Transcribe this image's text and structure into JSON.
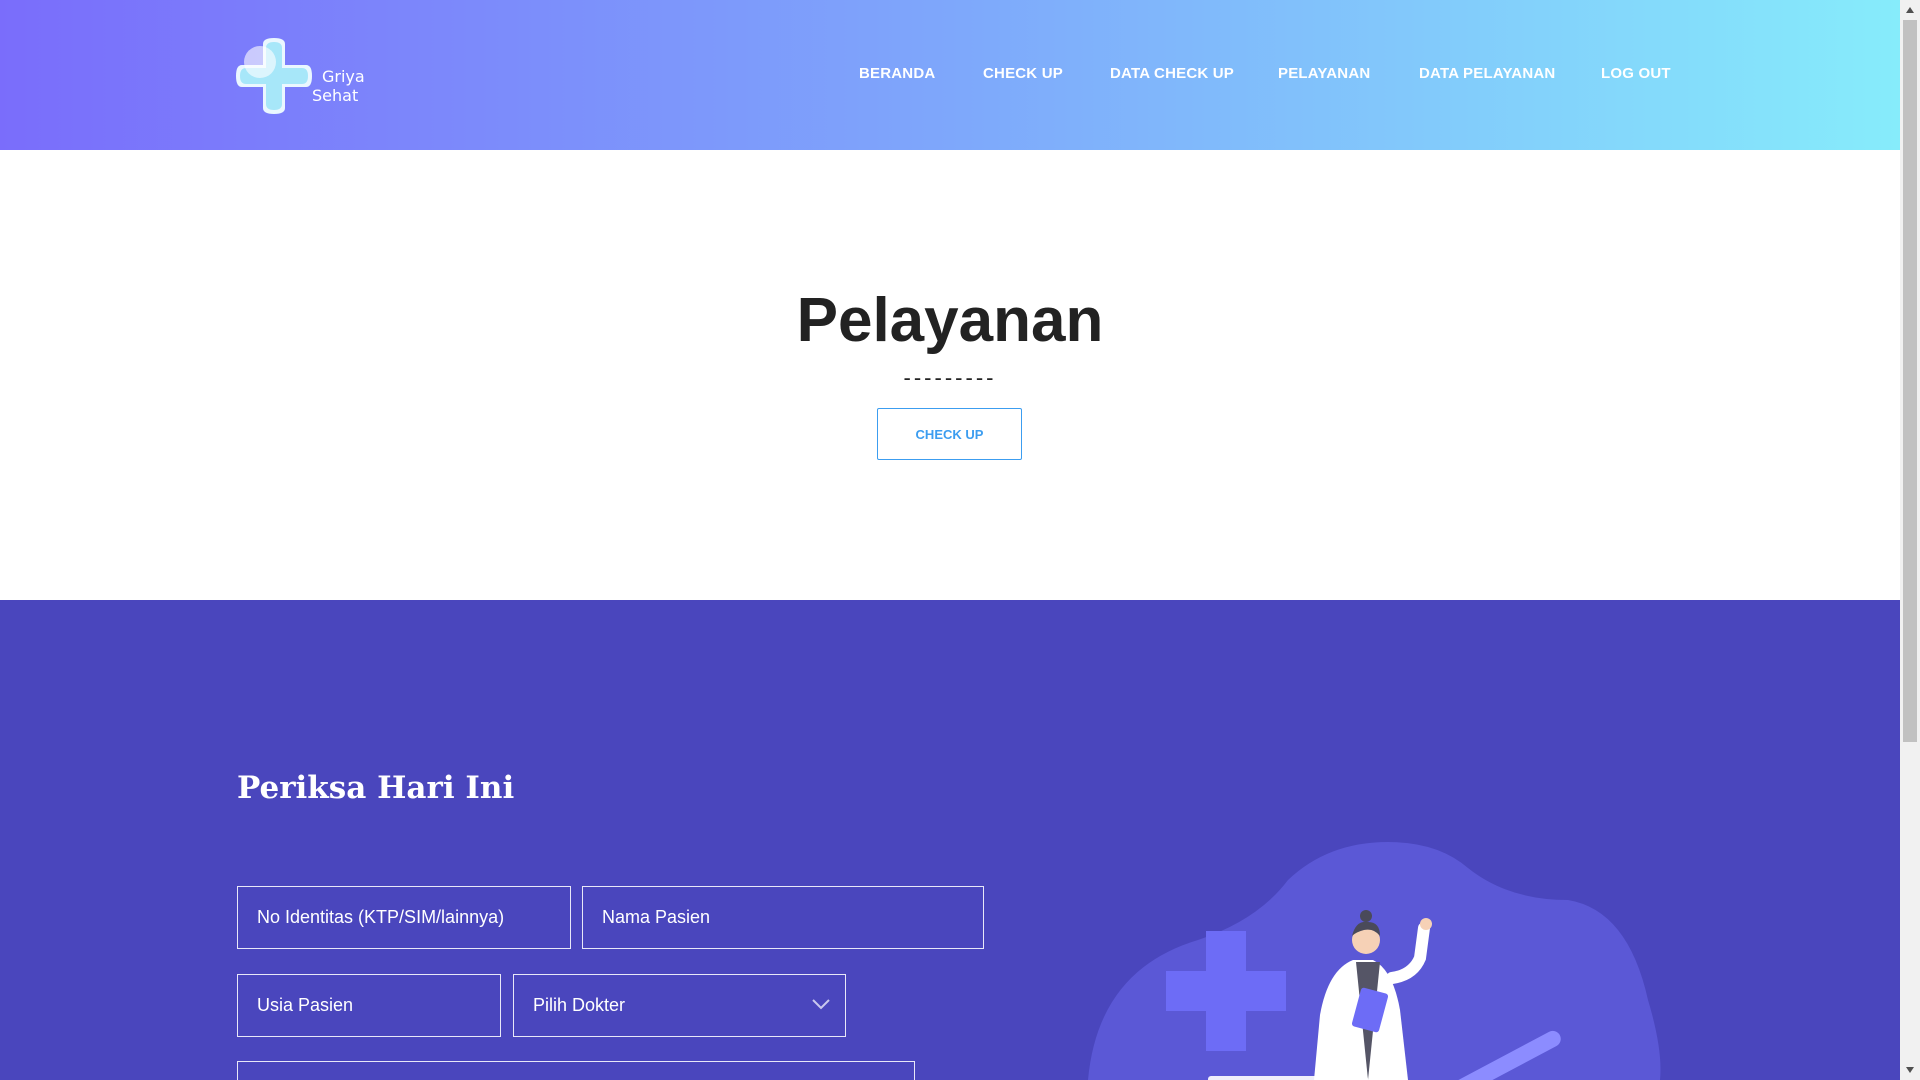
{
  "brand": {
    "line1": "Griya",
    "line2": "Sehat",
    "logo_icon": "medical-cross-logo"
  },
  "nav": {
    "beranda": "BERANDA",
    "check_up": "CHECK UP",
    "data_check_up": "DATA CHECK UP",
    "pelayanan": "PELAYANAN",
    "data_pelayanan": "DATA PELAYANAN",
    "log_out": "LOG OUT"
  },
  "hero": {
    "title": "Pelayanan",
    "divider": "---------",
    "button": "CHECK UP"
  },
  "form": {
    "title": "Periksa Hari Ini",
    "no_identitas": "No Identitas (KTP/SIM/lainnya)",
    "nama_pasien": "Nama Pasien",
    "usia_pasien": "Usia Pasien",
    "pilih_dokter": "Pilih Dokter"
  },
  "colors": {
    "header_gradient_start": "#7a6dfb",
    "header_gradient_end": "#86ecfb",
    "section_bg": "#4a46bd",
    "accent": "#3c9df0",
    "title_text": "#222222"
  },
  "illustration": "doctor-illustration"
}
